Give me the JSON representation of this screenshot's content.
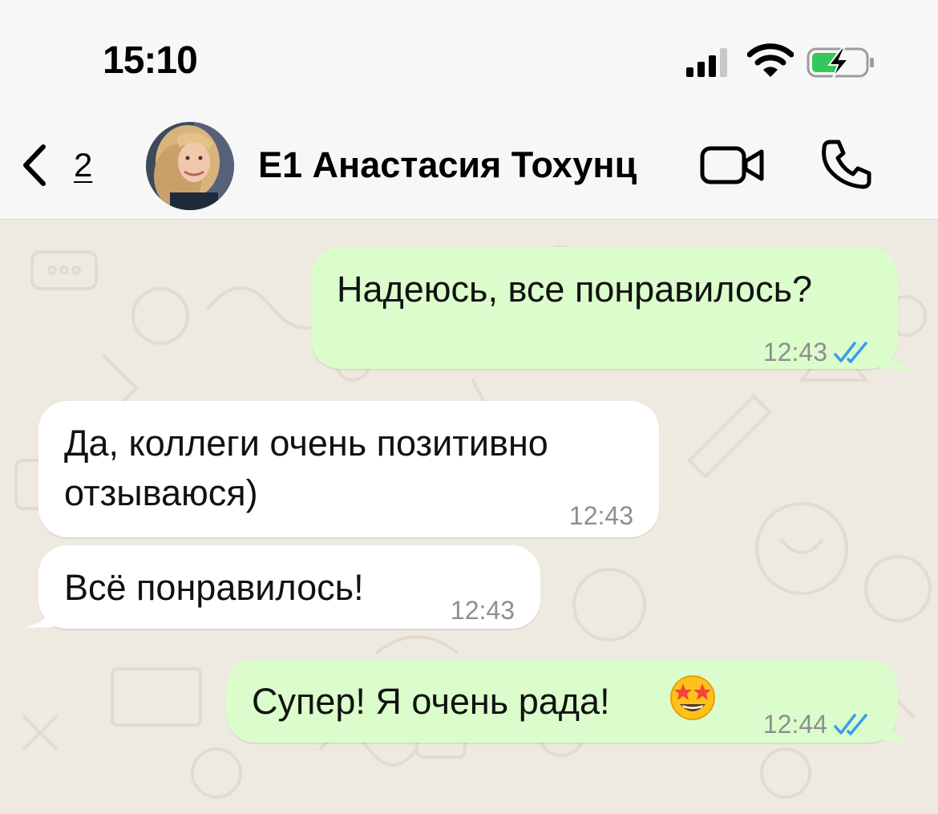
{
  "status_bar": {
    "time": "15:10"
  },
  "header": {
    "back_count": "2",
    "contact_name": "E1 Анастасия Тохунц"
  },
  "messages": [
    {
      "direction": "outgoing",
      "text": "Надеюсь, все понравилось?",
      "time": "12:43",
      "read": true
    },
    {
      "direction": "incoming",
      "lines": [
        "Да, коллеги очень позитивно",
        "отзываюся)"
      ],
      "time": "12:43"
    },
    {
      "direction": "incoming",
      "text": "Всё понравилось!",
      "time": "12:43"
    },
    {
      "direction": "outgoing",
      "text": "Супер! Я очень рада!",
      "emoji": "star-struck-emoji",
      "time": "12:44",
      "read": true
    }
  ],
  "colors": {
    "outgoing_bubble": "#dbfdcb",
    "incoming_bubble": "#ffffff",
    "chat_background": "#efeae1",
    "read_ticks": "#3a9bf0",
    "battery_charge": "#34c759"
  },
  "icons": {
    "back": "chevron-left-icon",
    "video": "video-camera-icon",
    "call": "phone-icon",
    "signal": "cellular-signal-icon",
    "wifi": "wifi-icon",
    "battery": "battery-charging-icon",
    "read": "double-check-icon"
  }
}
